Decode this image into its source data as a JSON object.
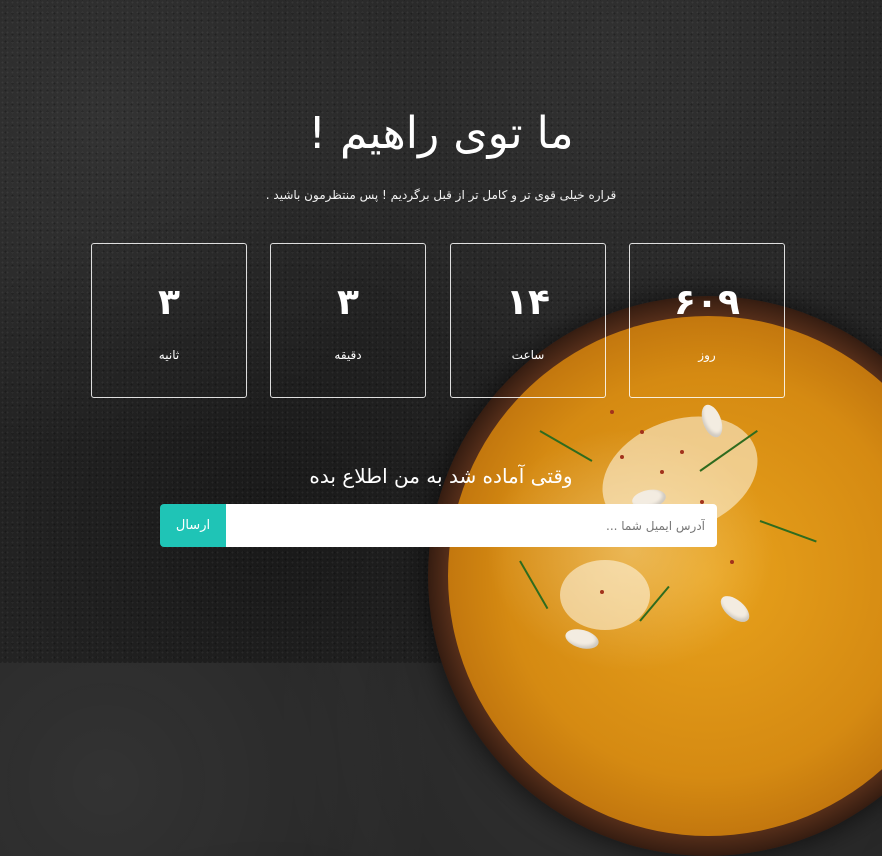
{
  "hero": {
    "title": "ما توی راهیم !",
    "subtitle": "قراره خیلی قوی تر و کامل تر از قبل برگردیم ! پس منتظرمون باشید ."
  },
  "countdown": [
    {
      "value": "۶۰۹",
      "label": "روز"
    },
    {
      "value": "۱۴",
      "label": "ساعت"
    },
    {
      "value": "۳",
      "label": "دقیقه"
    },
    {
      "value": "۳",
      "label": "ثانیه"
    }
  ],
  "notify": {
    "heading": "وقتی آماده شد به من اطلاع بده",
    "email_placeholder": "آدرس ایمیل شما ...",
    "submit_label": "ارسال"
  },
  "colors": {
    "accent": "#1fc4b6",
    "background": "#262626",
    "text": "#ffffff"
  }
}
